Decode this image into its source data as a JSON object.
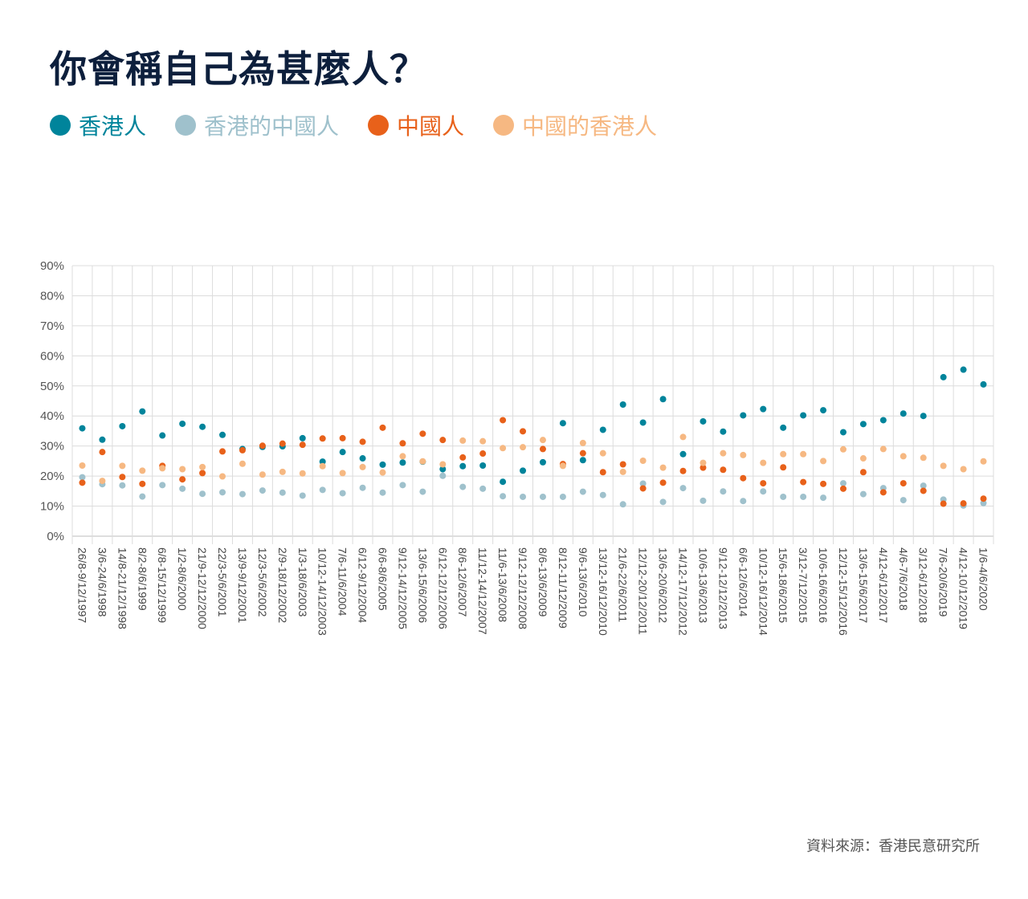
{
  "chart_data": {
    "type": "scatter",
    "title": "你會稱自己為甚麼人？",
    "ylim": [
      0,
      90
    ],
    "yticks": [
      "0%",
      "10%",
      "20%",
      "30%",
      "40%",
      "50%",
      "60%",
      "70%",
      "80%",
      "90%"
    ],
    "categories": [
      "26/8-9/12/1997",
      "3/6-24/6/1998",
      "14/8-21/12/1998",
      "8/2-8/6/1999",
      "6/8-15/12/1999",
      "1/2-8/6/2000",
      "21/9-12/12/2000",
      "22/3-5/6/2001",
      "13/9-9/12/2001",
      "12/3-5/6/2002",
      "2/9-18/12/2002",
      "1/3-18/6/2003",
      "10/12-14/12/2003",
      "7/6-11/6/2004",
      "6/12-9/12/2004",
      "6/6-8/6/2005",
      "9/12-14/12/2005",
      "13/6-15/6/2006",
      "6/12-12/12/2006",
      "8/6-12/6/2007",
      "11/12-14/12/2007",
      "11/6-13/6/2008",
      "9/12-12/12/2008",
      "8/6-13/6/2009",
      "8/12-11/12/2009",
      "9/6-13/6/2010",
      "13/12-16/12/2010",
      "21/6-22/6/2011",
      "12/12-20/12/2011",
      "13/6-20/6/2012",
      "14/12-17/12/2012",
      "10/6-13/6/2013",
      "9/12-12/12/2013",
      "6/6-12/6/2014",
      "10/12-16/12/2014",
      "15/6-18/6/2015",
      "3/12-7/12/2015",
      "10/6-16/6/2016",
      "12/12-15/12/2016",
      "13/6-15/6/2017",
      "4/12-6/12/2017",
      "4/6-7/6/2018",
      "3/12-6/12/2018",
      "7/6-20/6/2019",
      "4/12-10/12/2019",
      "1/6-4/6/2020"
    ],
    "series": [
      {
        "name": "香港人",
        "color": "#00849b",
        "values": [
          35.9,
          32.1,
          36.6,
          41.5,
          33.5,
          37.4,
          36.4,
          33.7,
          29.0,
          29.7,
          29.9,
          32.6,
          24.8,
          28.0,
          25.9,
          23.8,
          24.5,
          24.8,
          22.3,
          23.3,
          23.5,
          18.1,
          21.8,
          24.6,
          37.6,
          25.3,
          35.4,
          43.8,
          37.8,
          45.6,
          27.3,
          38.2,
          34.8,
          40.2,
          42.3,
          36.1,
          40.2,
          41.9,
          34.6,
          37.3,
          38.6,
          40.8,
          40.0,
          52.9,
          55.4,
          50.5
        ]
      },
      {
        "name": "香港的中國人",
        "color": "#9fc1cc",
        "values": [
          19.6,
          17.3,
          16.9,
          13.2,
          17.0,
          15.8,
          14.1,
          14.6,
          14.0,
          15.2,
          14.5,
          13.5,
          15.4,
          14.3,
          16.1,
          14.5,
          17.0,
          14.8,
          20.1,
          16.4,
          15.8,
          13.3,
          13.1,
          13.1,
          13.1,
          14.8,
          13.7,
          10.6,
          17.5,
          11.4,
          16.0,
          11.8,
          14.9,
          11.7,
          14.9,
          13.1,
          13.1,
          12.8,
          17.6,
          14.0,
          16.0,
          12.0,
          16.8,
          12.2,
          10.2,
          11.0
        ]
      },
      {
        "name": "中國人",
        "color": "#e8611a",
        "values": [
          17.8,
          28.0,
          19.7,
          17.4,
          23.4,
          18.9,
          21.0,
          28.2,
          28.6,
          30.1,
          30.8,
          30.4,
          32.5,
          32.6,
          31.4,
          36.1,
          30.9,
          34.1,
          32.0,
          26.2,
          27.5,
          38.6,
          34.9,
          29.0,
          24.0,
          27.6,
          21.3,
          23.9,
          15.9,
          17.8,
          21.7,
          22.8,
          22.1,
          19.3,
          17.6,
          22.9,
          18.0,
          17.4,
          15.8,
          21.3,
          14.6,
          17.6,
          15.1,
          10.8,
          10.9,
          12.5
        ]
      },
      {
        "name": "中國的香港人",
        "color": "#f6b882",
        "values": [
          23.5,
          18.4,
          23.4,
          21.8,
          22.6,
          22.3,
          23.0,
          19.9,
          24.1,
          20.5,
          21.4,
          20.9,
          23.3,
          21.0,
          23.0,
          21.2,
          26.6,
          24.9,
          23.9,
          31.8,
          31.6,
          29.3,
          29.6,
          32.0,
          23.4,
          31.0,
          27.6,
          21.4,
          25.1,
          22.8,
          33.0,
          24.4,
          27.6,
          27.0,
          24.4,
          27.3,
          27.3,
          25.0,
          28.9,
          25.9,
          29.0,
          26.6,
          26.1,
          23.4,
          22.3,
          24.9
        ]
      }
    ],
    "grid": true,
    "legend_position": "top-left"
  },
  "source": "資料來源：香港民意研究所"
}
